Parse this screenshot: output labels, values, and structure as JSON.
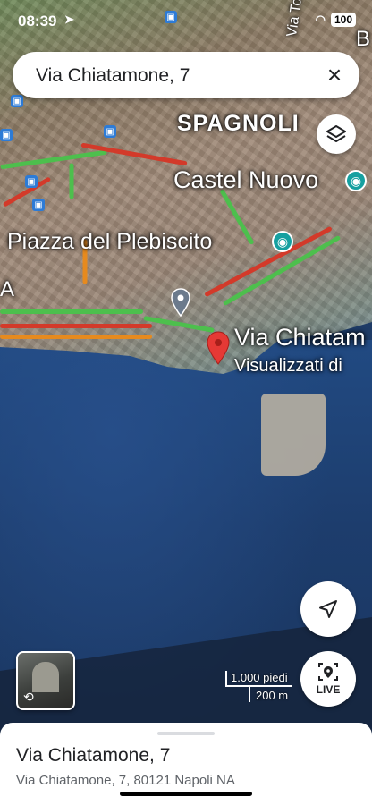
{
  "status_bar": {
    "time": "08:39",
    "battery": "100"
  },
  "search": {
    "query": "Via Chiatamone, 7"
  },
  "map": {
    "labels": {
      "quartieri": "SPAGNOLI",
      "castel": "Castel Nuovo",
      "plebiscito": "Piazza del Plebiscito",
      "toledo": "Via Tole",
      "selected_place": "Via Chiatam",
      "visited": "Visualizzati di",
      "edge_a": "A",
      "edge_b": "B"
    },
    "scale": {
      "imperial": "1.000 piedi",
      "metric": "200 m"
    }
  },
  "controls": {
    "live_label": "LIVE"
  },
  "place_sheet": {
    "title": "Via Chiatamone, 7",
    "address": "Via Chiatamone, 7, 80121 Napoli NA"
  },
  "colors": {
    "traffic_green": "#4dbf4d",
    "traffic_red": "#d33a2a",
    "traffic_orange": "#e68a1e",
    "pin_red": "#e53935"
  }
}
